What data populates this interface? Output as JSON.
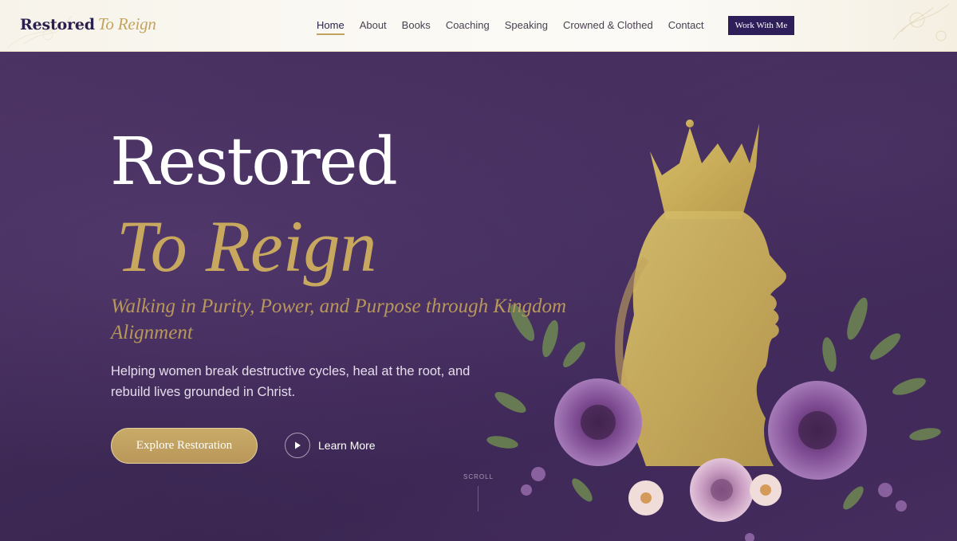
{
  "header": {
    "brand_main": "Restored",
    "brand_accent": "To Reign",
    "nav": [
      {
        "label": "Home",
        "active": true
      },
      {
        "label": "About",
        "active": false
      },
      {
        "label": "Books",
        "active": false
      },
      {
        "label": "Coaching",
        "active": false
      },
      {
        "label": "Speaking",
        "active": false
      },
      {
        "label": "Crowned & Clothed",
        "active": false
      },
      {
        "label": "Contact",
        "active": false
      }
    ],
    "cta_label": "Work With Me"
  },
  "hero": {
    "title_line1": "Restored",
    "title_line2": "To Reign",
    "tagline": "Walking in Purity, Power, and Purpose through Kingdom Alignment",
    "description": "Helping women break destructive cycles, heal at the root, and rebuild lives grounded in Christ.",
    "primary_button": "Explore Restoration",
    "secondary_button": "Learn More",
    "scroll_label": "SCROLL"
  },
  "colors": {
    "brand_navy": "#2a1f4d",
    "gold": "#c3a45e",
    "hero_purple": "#3f2a55",
    "cta_bg": "#2e1f5a"
  },
  "icons": [
    "play-icon",
    "crown-silhouette-icon"
  ]
}
